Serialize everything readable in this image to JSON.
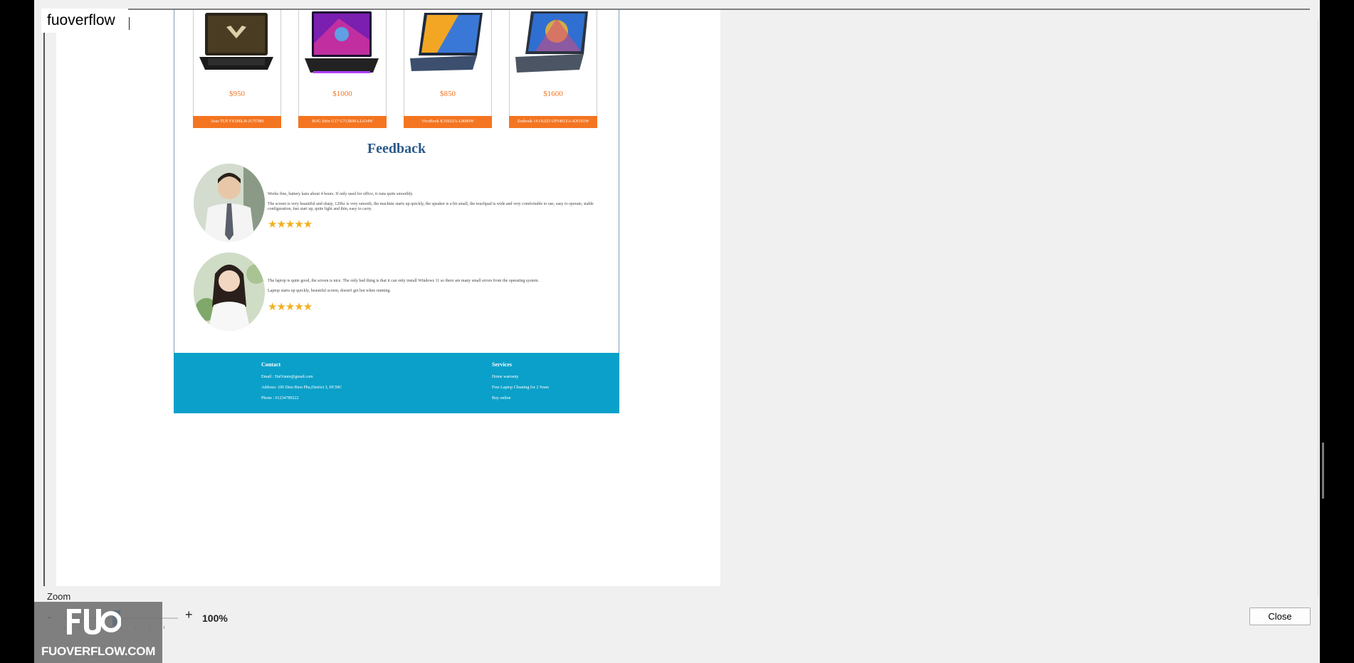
{
  "watermark": {
    "text": "fuoverflow"
  },
  "products": [
    {
      "price": "$950",
      "name": "Asus TUF FX506LH-J17578H",
      "accent": "#f47521"
    },
    {
      "price": "$1000",
      "name": "ROG Strix G17 G713RM-LL034W",
      "accent": "#f47521"
    },
    {
      "price": "$850",
      "name": "VivoBook K3502ZA-L8080W",
      "accent": "#f47521"
    },
    {
      "price": "$1600",
      "name": "Zenbook 14 OLED UP5401ZA-KN101W",
      "accent": "#f47521"
    }
  ],
  "feedback": {
    "title": "Feedback",
    "reviews": [
      {
        "line1": "Works fine, battery lasts about 4 hours. If only used for office, it runs quite smoothly.",
        "line2": "The screen is very beautiful and sharp, 120hz is very smooth, the machine starts up quickly, the speaker is a bit small, the touchpad is wide and very comfortable to use, easy to operate, stable configuration, fast start up, quite light and thin, easy to carry.",
        "rating": 5,
        "stars": "★★★★★"
      },
      {
        "line1": "The laptop is quite good, the screen is nice. The only bad thing is that it can only install Windows 11 so there are many small errors from the operating system.",
        "line2": "Laptop starts up quickly, beautiful screen, doesn't get hot when running.",
        "rating": 5,
        "stars": "★★★★★"
      }
    ]
  },
  "footer": {
    "contact": {
      "heading": "Contact",
      "email": "Email : HaiVanm@gmail.com",
      "address": "Address: 100 Dien Bien Phu,District 3, HCMC",
      "phone": "Phone : 01234789222"
    },
    "services": {
      "heading": "Services",
      "item1": "Home warranty",
      "item2": "Free Laptop Cleaning for 2 Years",
      "item3": "Buy online"
    },
    "color": "#0ba0c9"
  },
  "zoom": {
    "label": "Zoom",
    "minus": "-",
    "plus": "+",
    "value": "100%"
  },
  "close_label": "Close",
  "logo": {
    "text": "FUOVERFLOW.COM"
  }
}
